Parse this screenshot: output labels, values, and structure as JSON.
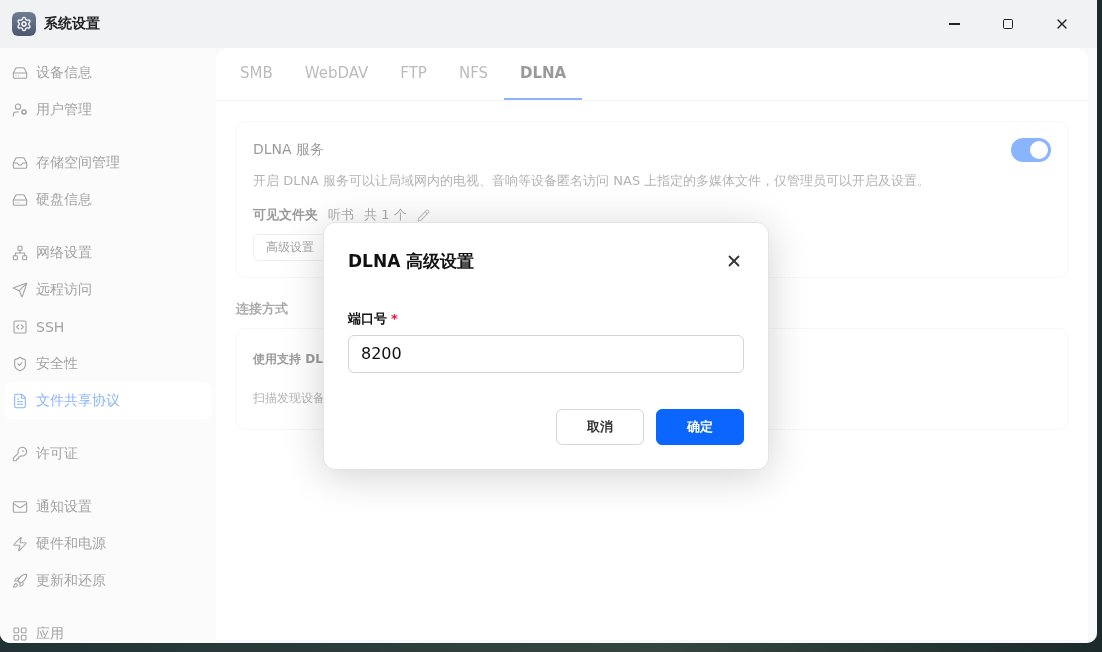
{
  "window": {
    "title": "系统设置"
  },
  "sidebar": {
    "groups": [
      {
        "items": [
          {
            "label": "设备信息",
            "selected": false
          },
          {
            "label": "用户管理",
            "selected": false
          }
        ]
      },
      {
        "items": [
          {
            "label": "存储空间管理",
            "selected": false
          },
          {
            "label": "硬盘信息",
            "selected": false
          }
        ]
      },
      {
        "items": [
          {
            "label": "网络设置",
            "selected": false
          },
          {
            "label": "远程访问",
            "selected": false
          },
          {
            "label": "SSH",
            "selected": false
          },
          {
            "label": "安全性",
            "selected": false
          },
          {
            "label": "文件共享协议",
            "selected": true
          }
        ]
      },
      {
        "items": [
          {
            "label": "许可证",
            "selected": false
          }
        ]
      },
      {
        "items": [
          {
            "label": "通知设置",
            "selected": false
          },
          {
            "label": "硬件和电源",
            "selected": false
          },
          {
            "label": "更新和还原",
            "selected": false
          }
        ]
      },
      {
        "items": [
          {
            "label": "应用",
            "selected": false
          }
        ]
      }
    ]
  },
  "tabs": [
    {
      "label": "SMB",
      "selected": false
    },
    {
      "label": "WebDAV",
      "selected": false
    },
    {
      "label": "FTP",
      "selected": false
    },
    {
      "label": "NFS",
      "selected": false
    },
    {
      "label": "DLNA",
      "selected": true
    }
  ],
  "service": {
    "title": "DLNA 服务",
    "on": true,
    "description": "开启 DLNA 服务可以让局域网内的电视、音响等设备匿名访问 NAS 上指定的多媒体文件，仅管理员可以开启及设置。",
    "folders_label": "可见文件夹",
    "folders": "听书",
    "folders_count": "共 1 个",
    "advanced_button": "高级设置"
  },
  "connection": {
    "title": "连接方式",
    "rows": [
      "使用支持 DL",
      "扫描发现设备"
    ]
  },
  "dialog": {
    "title": "DLNA 高级设置",
    "field": {
      "label": "端口号",
      "required_mark": "*",
      "value": "8200"
    },
    "buttons": [
      {
        "label": "取消",
        "kind": "secondary"
      },
      {
        "label": "确定",
        "kind": "primary"
      }
    ]
  }
}
